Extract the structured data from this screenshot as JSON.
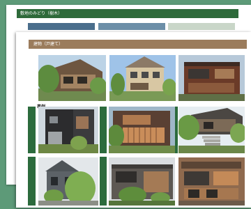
{
  "back_sheet": {
    "header_title": "敷地のみどり（樹木）",
    "header_color": "#2e6a3a"
  },
  "front_sheet": {
    "header_title": "建物（戸建て）",
    "header_color": "#9b7c5c",
    "row_label": "事例",
    "accent_color": "#2c6b3d"
  },
  "photos": [
    {
      "icon": "house-photo-wood-balcony"
    },
    {
      "icon": "house-photo-beige-gable"
    },
    {
      "icon": "house-photo-brown-flat-roof"
    },
    {
      "icon": "house-photo-dark-siding"
    },
    {
      "icon": "house-photo-wood-slats"
    },
    {
      "icon": "house-photo-modern-steps"
    },
    {
      "icon": "house-photo-grey-gable"
    },
    {
      "icon": "house-photo-wood-deck"
    },
    {
      "icon": "house-photo-glass-front"
    }
  ]
}
